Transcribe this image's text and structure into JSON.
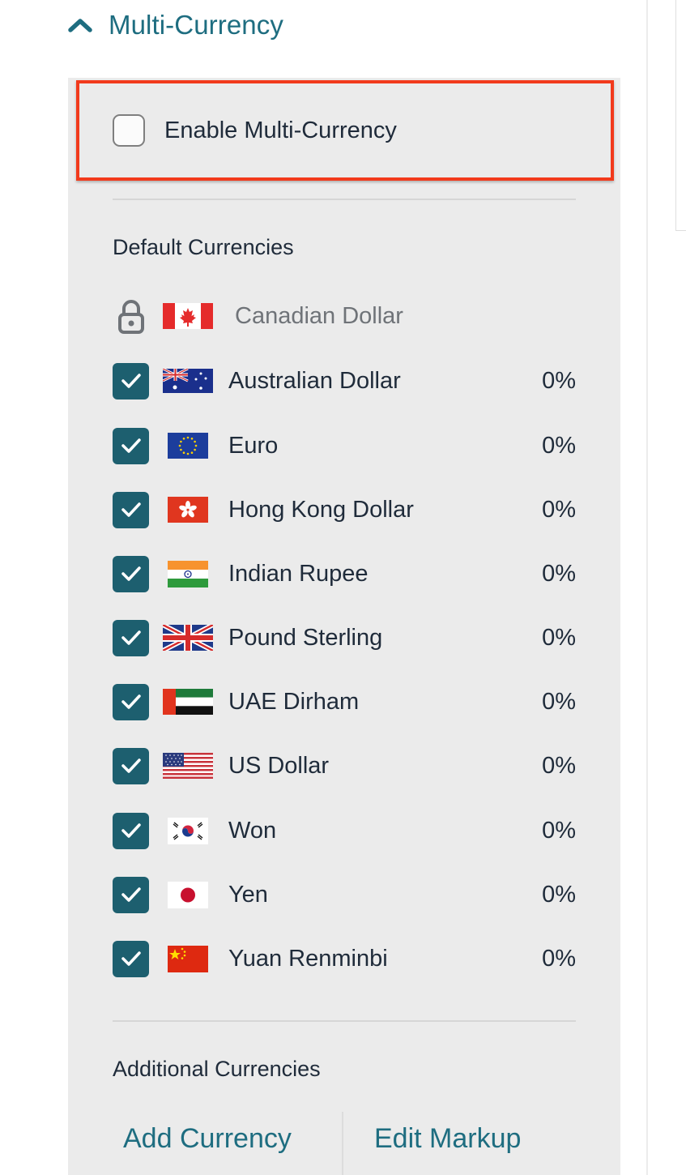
{
  "section": {
    "title": "Multi-Currency",
    "expanded": true
  },
  "enable": {
    "label": "Enable Multi-Currency",
    "checked": false,
    "highlight_color": "#f23a1c"
  },
  "default_currencies": {
    "title": "Default Currencies",
    "locked": {
      "name": "Canadian Dollar",
      "flag": "flag-canada"
    },
    "items": [
      {
        "name": "Australian Dollar",
        "markup": "0%",
        "checked": true,
        "flag": "flag-australia"
      },
      {
        "name": "Euro",
        "markup": "0%",
        "checked": true,
        "flag": "flag-eu"
      },
      {
        "name": "Hong Kong Dollar",
        "markup": "0%",
        "checked": true,
        "flag": "flag-hong-kong"
      },
      {
        "name": "Indian Rupee",
        "markup": "0%",
        "checked": true,
        "flag": "flag-india"
      },
      {
        "name": "Pound Sterling",
        "markup": "0%",
        "checked": true,
        "flag": "flag-uk"
      },
      {
        "name": "UAE Dirham",
        "markup": "0%",
        "checked": true,
        "flag": "flag-uae"
      },
      {
        "name": "US Dollar",
        "markup": "0%",
        "checked": true,
        "flag": "flag-usa"
      },
      {
        "name": "Won",
        "markup": "0%",
        "checked": true,
        "flag": "flag-south-korea"
      },
      {
        "name": "Yen",
        "markup": "0%",
        "checked": true,
        "flag": "flag-japan"
      },
      {
        "name": "Yuan Renminbi",
        "markup": "0%",
        "checked": true,
        "flag": "flag-china"
      }
    ]
  },
  "additional_currencies": {
    "title": "Additional Currencies"
  },
  "actions": {
    "add_label": "Add Currency",
    "edit_label": "Edit Markup"
  },
  "colors": {
    "accent": "#1e6d80",
    "checkbox": "#1d5f6f",
    "panel": "#ebebeb",
    "text": "#1f2b3a"
  }
}
